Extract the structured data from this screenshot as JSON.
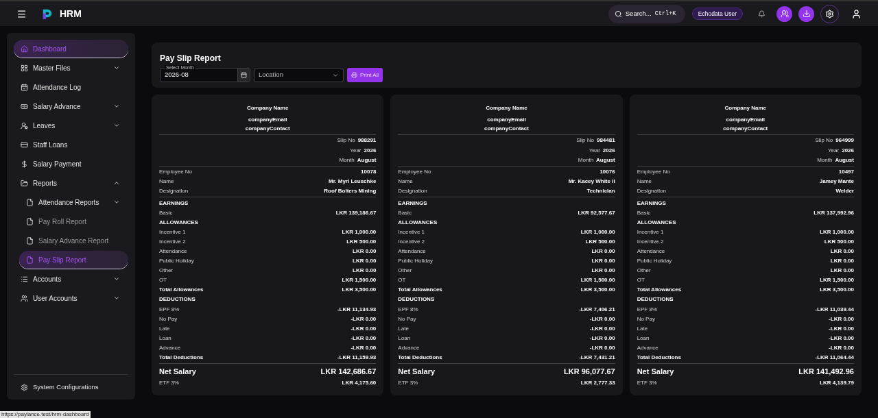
{
  "header": {
    "app_name": "HRM",
    "search": {
      "placeholder": "Search...",
      "shortcut": "Ctrl+K"
    },
    "user_badge": "Echodata User"
  },
  "sidebar": {
    "items": [
      {
        "label": "Dashboard",
        "selected": true
      },
      {
        "label": "Master Files",
        "selected": false,
        "expanded": false
      },
      {
        "label": "Attendance Log",
        "selected": false
      },
      {
        "label": "Salary Advance",
        "selected": false,
        "expanded": false
      },
      {
        "label": "Leaves",
        "selected": false,
        "expanded": false
      },
      {
        "label": "Staff Loans",
        "selected": false
      },
      {
        "label": "Salary Payment",
        "selected": false
      },
      {
        "label": "Reports",
        "selected": false,
        "expanded": true,
        "children": [
          {
            "label": "Attendance Reports",
            "selected": false,
            "expanded": false
          },
          {
            "label": "Pay Roll Report",
            "selected": false
          },
          {
            "label": "Salary Advance Report",
            "selected": false
          },
          {
            "label": "Pay Slip Report",
            "selected": true
          }
        ]
      },
      {
        "label": "Accounts",
        "selected": false,
        "expanded": false
      },
      {
        "label": "User Accounts",
        "selected": false,
        "expanded": false
      }
    ],
    "footer_item": "System Configurations"
  },
  "toolbar": {
    "title": "Pay Slip Report",
    "month": {
      "label": "Select Month",
      "value": "2026-08"
    },
    "location": {
      "placeholder": "Location"
    },
    "print_button": "Print All"
  },
  "slips": [
    {
      "company": [
        "Company Name",
        "companyEmail",
        "companyContact"
      ],
      "meta": [
        {
          "label": "Slip No",
          "value": "988291"
        },
        {
          "label": "Year",
          "value": "2026"
        },
        {
          "label": "Month",
          "value": "August"
        }
      ],
      "employee": [
        {
          "label": "Employee No",
          "value": "10078"
        },
        {
          "label": "Name",
          "value": "Mr. Myrl Leuschke"
        },
        {
          "label": "Designation",
          "value": "Roof Bolters Mining"
        }
      ],
      "rows": [
        {
          "kind": "heading",
          "label": "EARNINGS"
        },
        {
          "kind": "item",
          "label": "Basic",
          "value": "LKR 139,186.67"
        },
        {
          "kind": "heading",
          "label": "ALLOWANCES"
        },
        {
          "kind": "item",
          "label": "Incentive 1",
          "value": "LKR 1,000.00"
        },
        {
          "kind": "item",
          "label": "Incentive 2",
          "value": "LKR 500.00"
        },
        {
          "kind": "item",
          "label": "Attendance",
          "value": "LKR 0.00"
        },
        {
          "kind": "item",
          "label": "Public Holiday",
          "value": "LKR 0.00"
        },
        {
          "kind": "item",
          "label": "Other",
          "value": "LKR 0.00"
        },
        {
          "kind": "item",
          "label": "OT",
          "value": "LKR 1,500.00"
        },
        {
          "kind": "total",
          "label": "Total Allowances",
          "value": "LKR 3,500.00"
        },
        {
          "kind": "heading",
          "label": "DEDUCTIONS"
        },
        {
          "kind": "item",
          "label": "EPF 8%",
          "value": "-LKR 11,134.93"
        },
        {
          "kind": "item",
          "label": "No Pay",
          "value": "-LKR 0.00"
        },
        {
          "kind": "item",
          "label": "Late",
          "value": "-LKR 0.00"
        },
        {
          "kind": "item",
          "label": "Loan",
          "value": "-LKR 0.00"
        },
        {
          "kind": "item",
          "label": "Advance",
          "value": "-LKR 0.00"
        },
        {
          "kind": "total",
          "label": "Total Deductions",
          "value": "-LKR 11,159.93"
        }
      ],
      "net": {
        "label": "Net Salary",
        "value": "LKR 142,686.67"
      },
      "etf": {
        "label": "ETF 3%",
        "value": "LKR 4,175.60"
      }
    },
    {
      "company": [
        "Company Name",
        "companyEmail",
        "companyContact"
      ],
      "meta": [
        {
          "label": "Slip No",
          "value": "984481"
        },
        {
          "label": "Year",
          "value": "2026"
        },
        {
          "label": "Month",
          "value": "August"
        }
      ],
      "employee": [
        {
          "label": "Employee No",
          "value": "10076"
        },
        {
          "label": "Name",
          "value": "Mr. Kacey White II"
        },
        {
          "label": "Designation",
          "value": "Technician"
        }
      ],
      "rows": [
        {
          "kind": "heading",
          "label": "EARNINGS"
        },
        {
          "kind": "item",
          "label": "Basic",
          "value": "LKR 92,577.67"
        },
        {
          "kind": "heading",
          "label": "ALLOWANCES"
        },
        {
          "kind": "item",
          "label": "Incentive 1",
          "value": "LKR 1,000.00"
        },
        {
          "kind": "item",
          "label": "Incentive 2",
          "value": "LKR 500.00"
        },
        {
          "kind": "item",
          "label": "Attendance",
          "value": "LKR 0.00"
        },
        {
          "kind": "item",
          "label": "Public Holiday",
          "value": "LKR 0.00"
        },
        {
          "kind": "item",
          "label": "Other",
          "value": "LKR 0.00"
        },
        {
          "kind": "item",
          "label": "OT",
          "value": "LKR 1,500.00"
        },
        {
          "kind": "total",
          "label": "Total Allowances",
          "value": "LKR 3,500.00"
        },
        {
          "kind": "heading",
          "label": "DEDUCTIONS"
        },
        {
          "kind": "item",
          "label": "EPF 8%",
          "value": "-LKR 7,406.21"
        },
        {
          "kind": "item",
          "label": "No Pay",
          "value": "-LKR 0.00"
        },
        {
          "kind": "item",
          "label": "Late",
          "value": "-LKR 0.00"
        },
        {
          "kind": "item",
          "label": "Loan",
          "value": "-LKR 0.00"
        },
        {
          "kind": "item",
          "label": "Advance",
          "value": "-LKR 0.00"
        },
        {
          "kind": "total",
          "label": "Total Deductions",
          "value": "-LKR 7,431.21"
        }
      ],
      "net": {
        "label": "Net Salary",
        "value": "LKR 96,077.67"
      },
      "etf": {
        "label": "ETF 3%",
        "value": "LKR 2,777.33"
      }
    },
    {
      "company": [
        "Company Name",
        "companyEmail",
        "companyContact"
      ],
      "meta": [
        {
          "label": "Slip No",
          "value": "964999"
        },
        {
          "label": "Year",
          "value": "2026"
        },
        {
          "label": "Month",
          "value": "August"
        }
      ],
      "employee": [
        {
          "label": "Employee No",
          "value": "10497"
        },
        {
          "label": "Name",
          "value": "Jamey Mante"
        },
        {
          "label": "Designation",
          "value": "Welder"
        }
      ],
      "rows": [
        {
          "kind": "heading",
          "label": "EARNINGS"
        },
        {
          "kind": "item",
          "label": "Basic",
          "value": "LKR 137,992.96"
        },
        {
          "kind": "heading",
          "label": "ALLOWANCES"
        },
        {
          "kind": "item",
          "label": "Incentive 1",
          "value": "LKR 1,000.00"
        },
        {
          "kind": "item",
          "label": "Incentive 2",
          "value": "LKR 500.00"
        },
        {
          "kind": "item",
          "label": "Attendance",
          "value": "LKR 0.00"
        },
        {
          "kind": "item",
          "label": "Public Holiday",
          "value": "LKR 0.00"
        },
        {
          "kind": "item",
          "label": "Other",
          "value": "LKR 0.00"
        },
        {
          "kind": "item",
          "label": "OT",
          "value": "LKR 1,500.00"
        },
        {
          "kind": "total",
          "label": "Total Allowances",
          "value": "LKR 3,500.00"
        },
        {
          "kind": "heading",
          "label": "DEDUCTIONS"
        },
        {
          "kind": "item",
          "label": "EPF 8%",
          "value": "-LKR 11,039.44"
        },
        {
          "kind": "item",
          "label": "No Pay",
          "value": "-LKR 0.00"
        },
        {
          "kind": "item",
          "label": "Late",
          "value": "-LKR 0.00"
        },
        {
          "kind": "item",
          "label": "Loan",
          "value": "-LKR 0.00"
        },
        {
          "kind": "item",
          "label": "Advance",
          "value": "-LKR 0.00"
        },
        {
          "kind": "total",
          "label": "Total Deductions",
          "value": "-LKR 11,064.44"
        }
      ],
      "net": {
        "label": "Net Salary",
        "value": "LKR 141,492.96"
      },
      "etf": {
        "label": "ETF 3%",
        "value": "LKR 4,139.79"
      }
    }
  ],
  "status_url": "https://paylance.test/hrm-dashboard"
}
